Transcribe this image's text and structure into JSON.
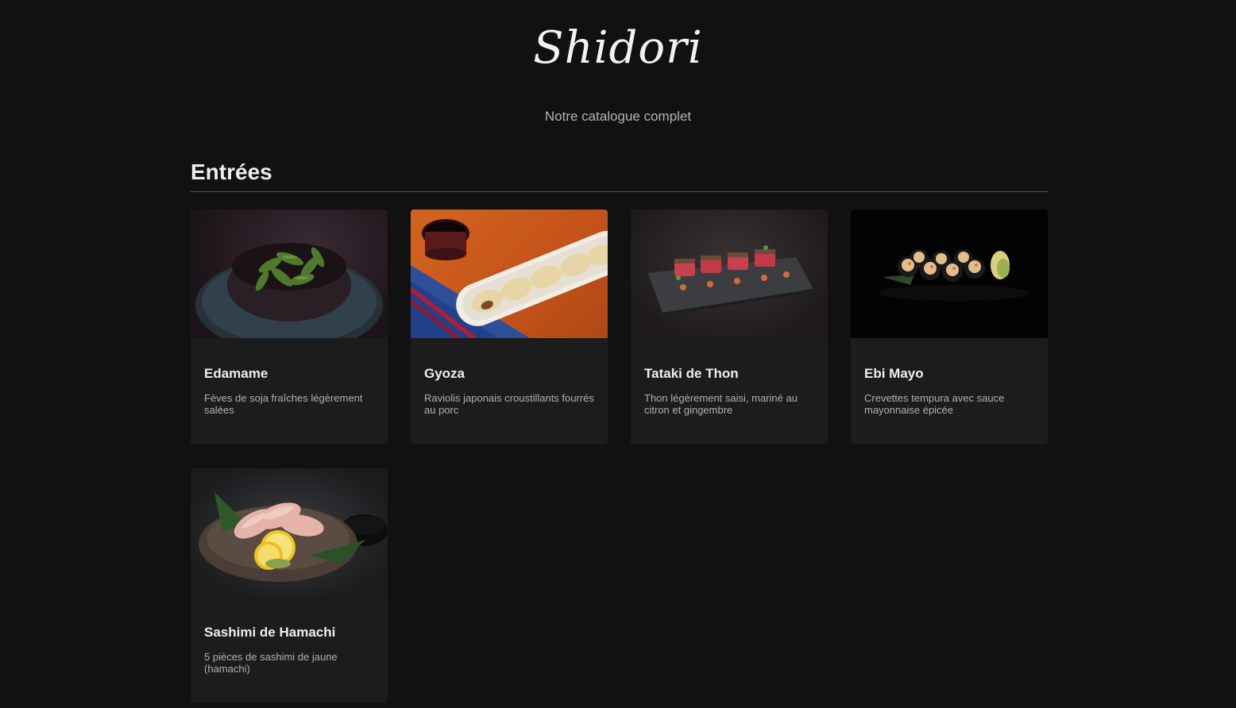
{
  "header": {
    "logo_text": "Shidori",
    "subtitle": "Notre catalogue complet"
  },
  "section": {
    "title": "Entrées"
  },
  "items": [
    {
      "name": "Edamame",
      "description": "Fèves de soja fraîches légèrement salées",
      "image": "edamame-bowl-photo"
    },
    {
      "name": "Gyoza",
      "description": "Raviolis japonais croustillants fourrés au porc",
      "image": "gyoza-plate-photo"
    },
    {
      "name": "Tataki de Thon",
      "description": "Thon légèrement saisi, mariné au citron et gingembre",
      "image": "tuna-tataki-slate-photo"
    },
    {
      "name": "Ebi Mayo",
      "description": "Crevettes tempura avec sauce mayonnaise épicée",
      "image": "ebi-mayo-rolls-photo"
    },
    {
      "name": "Sashimi de Hamachi",
      "description": "5 pièces de sashimi de jaune (hamachi)",
      "image": "hamachi-sashimi-photo"
    }
  ]
}
